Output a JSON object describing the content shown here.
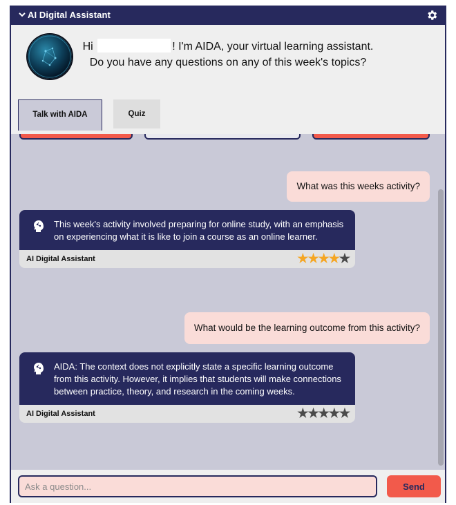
{
  "window": {
    "title": "AI Digital Assistant",
    "collapse_icon": "chevron-down-icon",
    "settings_icon": "gear-icon"
  },
  "header": {
    "greeting_hi": "Hi",
    "greeting_rest": "! I'm AIDA, your virtual learning assistant.",
    "greeting_line2": "Do you have any questions on any of this week's topics?"
  },
  "tabs": [
    {
      "label": "Talk with AIDA",
      "active": true
    },
    {
      "label": "Quiz",
      "active": false
    }
  ],
  "messages": [
    {
      "role": "user",
      "text": "What was this weeks activity?"
    },
    {
      "role": "assistant",
      "text": "This week's activity involved preparing for online study, with an emphasis on experiencing what it is like to join a course as an online learner.",
      "sender": "AI Digital Assistant",
      "rating": 4,
      "max_rating": 5
    },
    {
      "role": "user",
      "text": "What would be the learning outcome from this activity?"
    },
    {
      "role": "assistant",
      "text": "AIDA: The context does not explicitly state a specific learning outcome from this activity. However, it implies that students will make connections between practice, theory, and research in the coming weeks.",
      "sender": "AI Digital Assistant",
      "rating": 0,
      "max_rating": 5
    }
  ],
  "input": {
    "placeholder": "Ask a question...",
    "value": ""
  },
  "send_label": "Send",
  "colors": {
    "navy": "#27295d",
    "accent": "#f25a4b",
    "user_bubble": "#fadcd8",
    "chat_bg": "#c9c9d7",
    "star_on": "#f5a623"
  }
}
